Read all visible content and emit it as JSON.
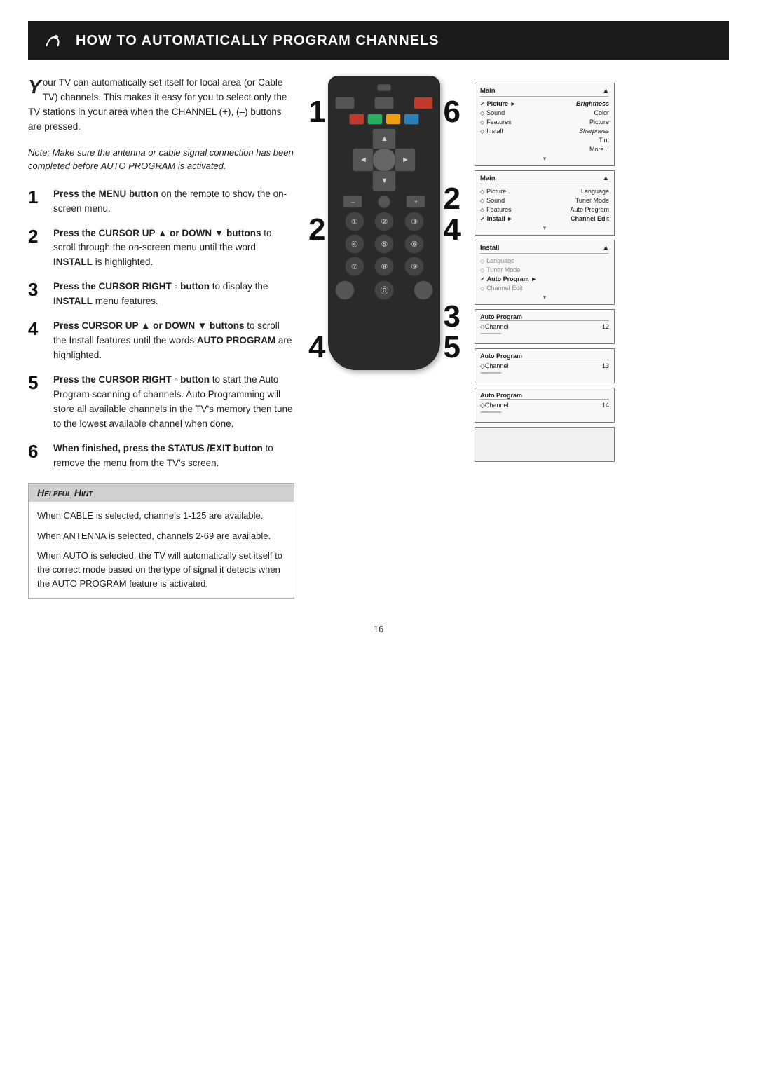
{
  "page": {
    "title": "How to Automatically Program Channels",
    "page_number": "16"
  },
  "intro": {
    "drop_cap": "Y",
    "text1": "our TV can automatically set itself for local area (or Cable TV) channels. This makes it easy for you to select only the TV stations in your area when the CHANNEL (+), (–) buttons are pressed.",
    "note": "Note: Make sure the antenna or cable signal connection has been completed before AUTO PROGRAM is activated."
  },
  "steps": [
    {
      "num": "1",
      "bold": "Press the MENU button",
      "text": " on the remote to show the on-screen menu."
    },
    {
      "num": "2",
      "bold": "Press the CURSOR UP ▲ or DOWN ▼ buttons",
      "text": " to scroll through the on-screen menu until the word INSTALL is highlighted."
    },
    {
      "num": "3",
      "bold": "Press the CURSOR RIGHT ◦ button",
      "text": " to display the INSTALL menu features."
    },
    {
      "num": "4",
      "bold": "Press CURSOR UP ▲ or DOWN ▼ buttons",
      "text": " to scroll the Install features until the words AUTO PROGRAM are highlighted."
    },
    {
      "num": "5",
      "bold": "Press the CURSOR RIGHT ◦ button",
      "text": " to start the Auto Program scanning of channels. Auto Programming will store all available channels in the TV's memory then tune to the lowest available channel when done."
    },
    {
      "num": "6",
      "bold": "When finished, press the STATUS /EXIT button",
      "text": " to remove the menu from the TV's screen."
    }
  ],
  "hint": {
    "title": "Helpful Hint",
    "items": [
      "When CABLE is selected, channels 1-125 are available.",
      "When ANTENNA is selected, channels 2-69 are available.",
      "When AUTO is selected, the TV will automatically set itself to the correct mode based on the type of signal it detects when the AUTO PROGRAM feature is activated."
    ]
  },
  "screens": {
    "screen1": {
      "header_left": "Main",
      "header_right": "▲",
      "rows": [
        {
          "sym": "✓",
          "label": "Picture",
          "arrow": "►",
          "value": "Brightness"
        },
        {
          "sym": "◇",
          "label": "Sound",
          "arrow": "",
          "value": "Color"
        },
        {
          "sym": "◇",
          "label": "Features",
          "arrow": "",
          "value": "Picture"
        },
        {
          "sym": "◇",
          "label": "Install",
          "arrow": "",
          "value": "Sharpness"
        },
        {
          "sym": "",
          "label": "",
          "arrow": "",
          "value": "Tint"
        },
        {
          "sym": "",
          "label": "",
          "arrow": "",
          "value": "More..."
        }
      ],
      "footer": "▼"
    },
    "screen2": {
      "header_left": "Main",
      "header_right": "▲",
      "rows": [
        {
          "sym": "◇",
          "label": "Picture",
          "arrow": "",
          "value": "Language"
        },
        {
          "sym": "◇",
          "label": "Sound",
          "arrow": "",
          "value": "Tuner Mode"
        },
        {
          "sym": "◇",
          "label": "Features",
          "arrow": "",
          "value": "Auto Program"
        },
        {
          "sym": "✓",
          "label": "Install",
          "arrow": "►",
          "value": "Channel Edit",
          "sel": true
        }
      ],
      "footer": "▼"
    },
    "screen3": {
      "header_left": "Install",
      "header_right": "▲",
      "rows": [
        {
          "sym": "◇",
          "label": "Language",
          "sel": false
        },
        {
          "sym": "◇",
          "label": "Tuner Mode",
          "sel": false
        },
        {
          "sym": "✓",
          "label": "Auto Program",
          "arrow": "►",
          "sel": true
        },
        {
          "sym": "◇",
          "label": "Channel Edit",
          "sel": false
        }
      ],
      "footer": "▼"
    },
    "screen4": {
      "label": "Auto Program",
      "rows": [
        {
          "sym": "◇",
          "label": "Channel",
          "value": "12"
        },
        {
          "dots": "◦◦◦◦◦◦◦◦◦◦◦◦◦◦◦◦◦◦◦◦"
        }
      ]
    },
    "screen5": {
      "label": "Auto Program",
      "rows": [
        {
          "sym": "◇",
          "label": "Channel",
          "value": "13"
        },
        {
          "dots": "◦◦◦◦◦◦◦◦◦◦◦◦◦◦◦◦◦◦◦◦"
        }
      ]
    },
    "screen6": {
      "label": "Auto Program",
      "rows": [
        {
          "sym": "◇",
          "label": "Channel",
          "value": "14"
        },
        {
          "dots": "◦◦◦◦◦◦◦◦◦◦◦◦◦◦◦◦◦◦◦◦"
        }
      ]
    }
  },
  "badges": {
    "left_top": "1",
    "left_mid": "2",
    "left_bot": "4",
    "right_top": "6",
    "right_mid": "2",
    "right_bot": "4"
  },
  "diagram_step_labels": {
    "top_left": "1",
    "mid_left_top": "2",
    "mid_left_bot": "4",
    "right_top": "6",
    "right_mid_top": "2",
    "right_mid_bot": "4",
    "right_bot": "3",
    "right_far": "5"
  }
}
